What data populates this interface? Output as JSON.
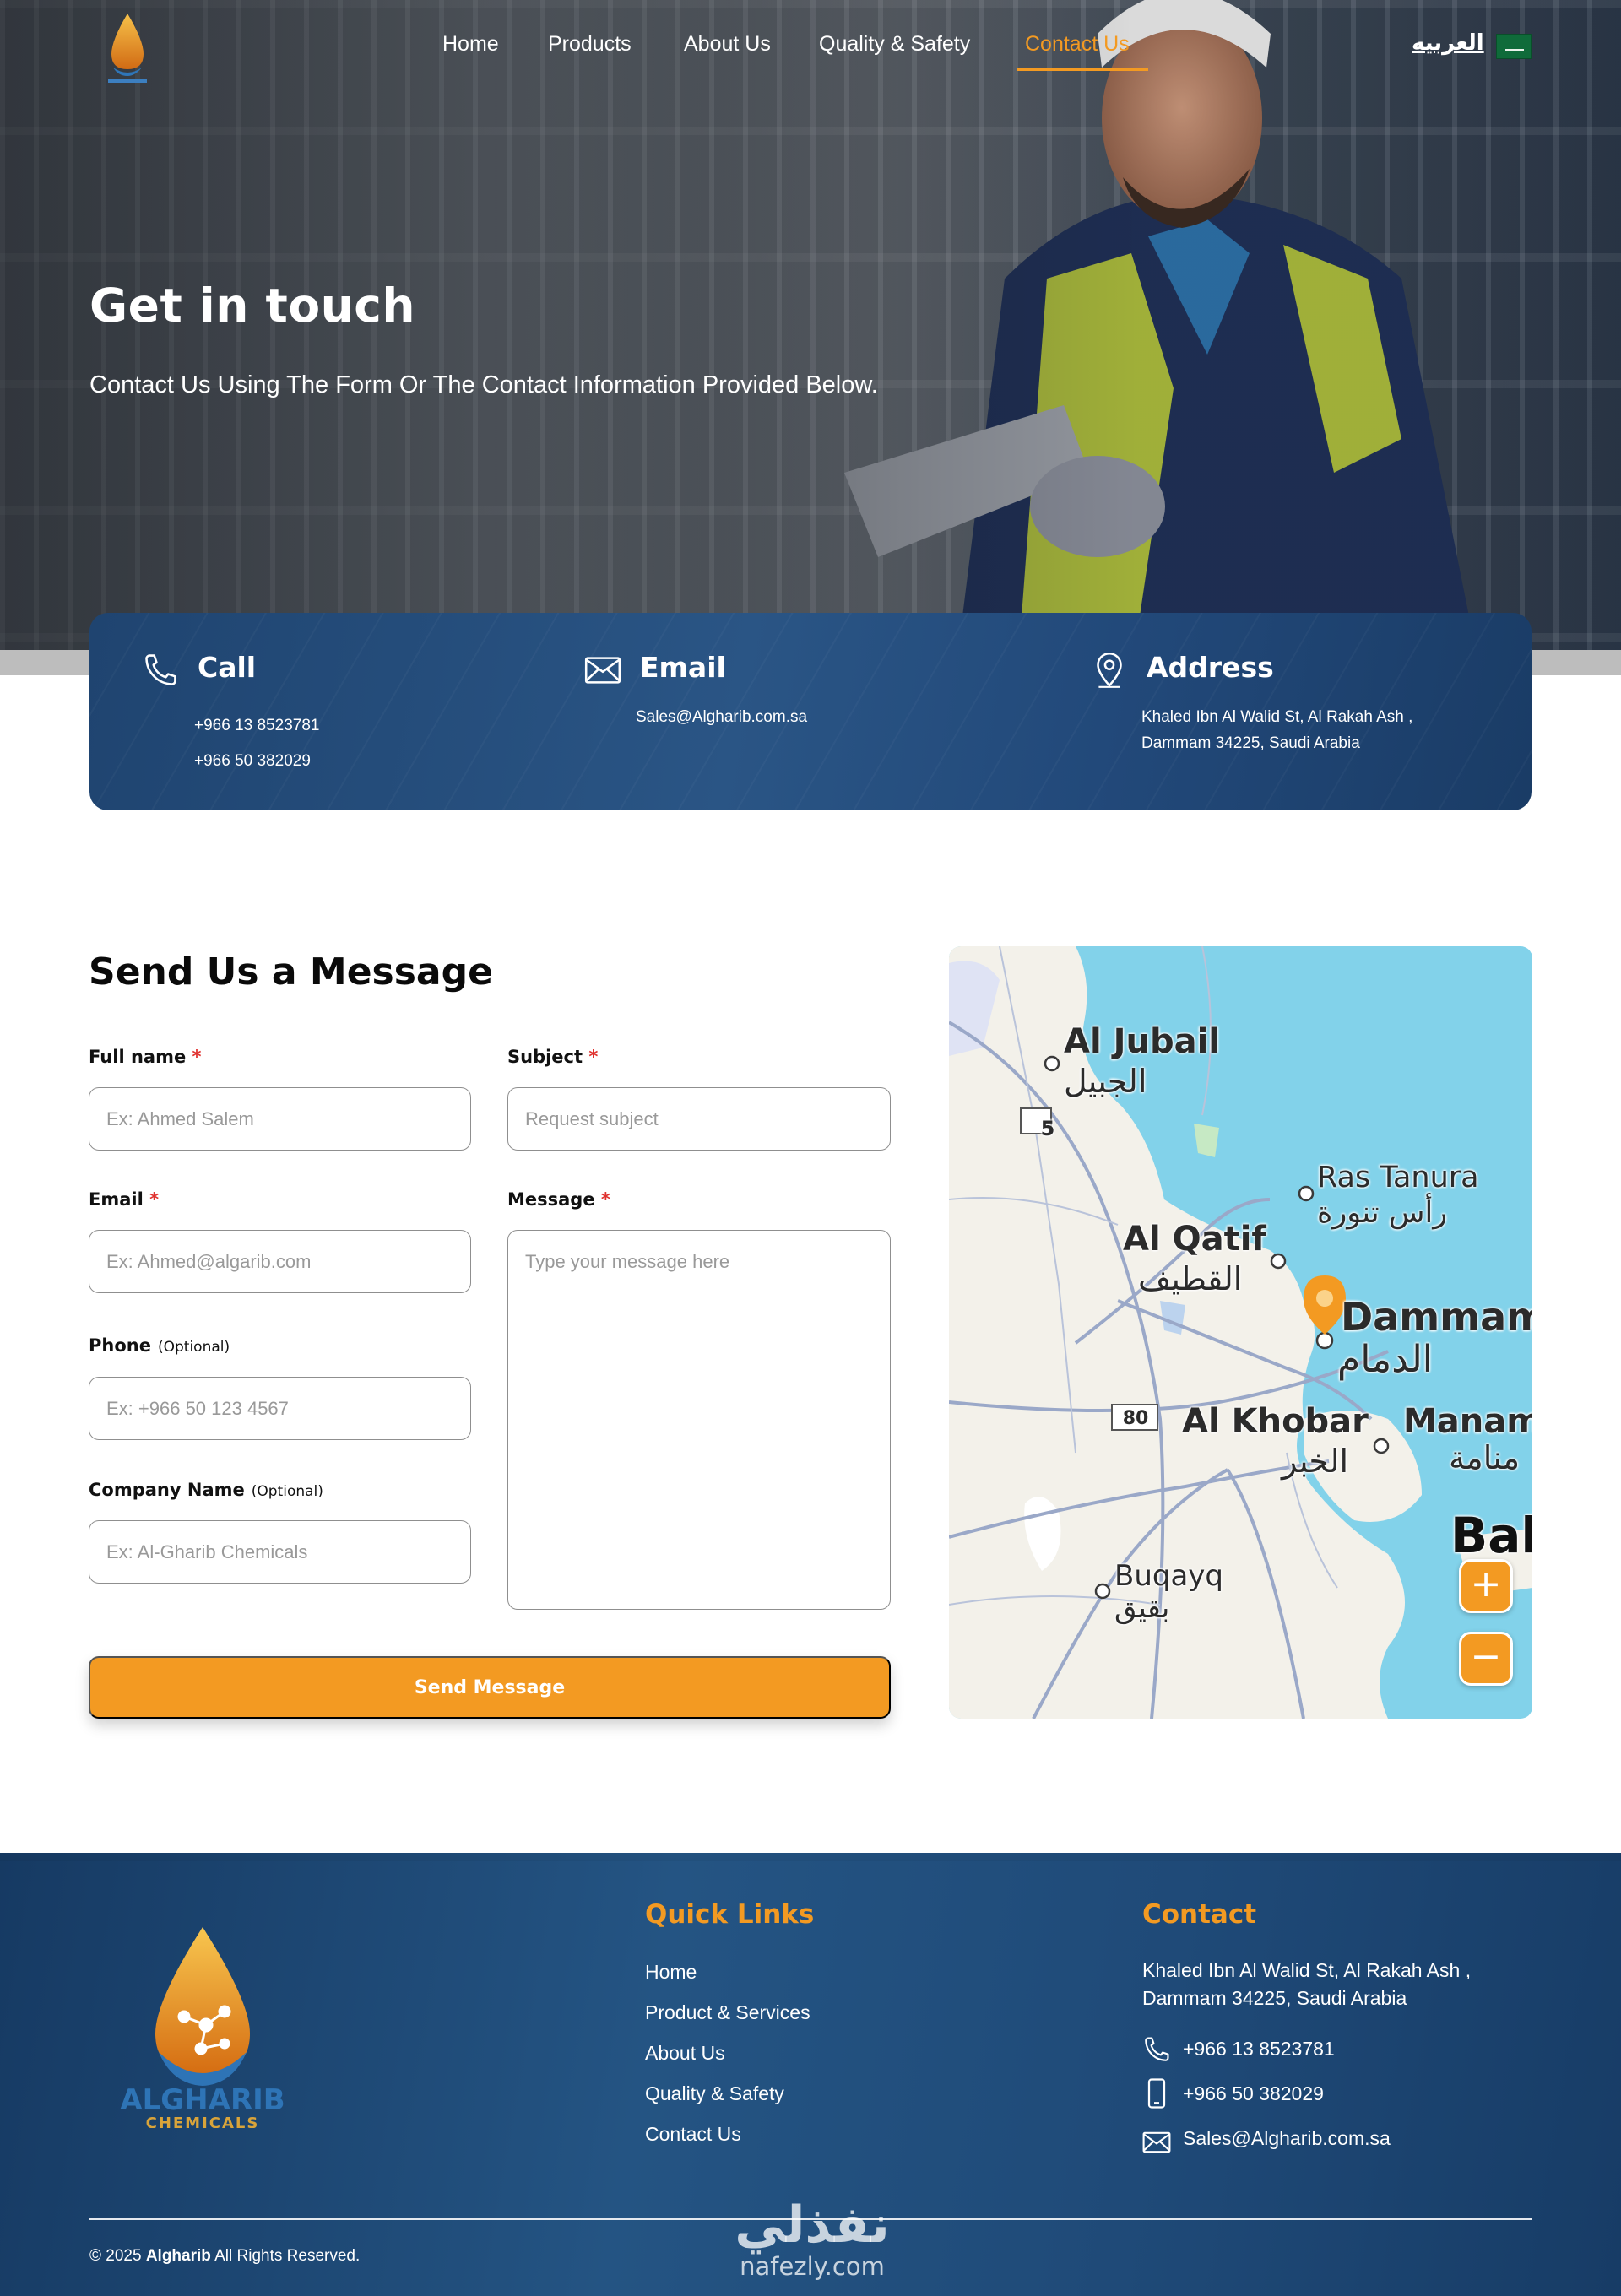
{
  "nav": {
    "items": [
      {
        "label": "Home"
      },
      {
        "label": "Products"
      },
      {
        "label": "About Us"
      },
      {
        "label": "Quality & Safety"
      },
      {
        "label": "Contact Us",
        "active": true
      }
    ],
    "language_label": "العربيه"
  },
  "hero": {
    "title": "Get in touch",
    "subtitle": "Contact Us Using The Form Or The Contact Information Provided Below."
  },
  "contact_card": {
    "call": {
      "title": "Call",
      "phone_1": "+966 13 8523781",
      "phone_2": "+966 50 382029"
    },
    "email": {
      "title": "Email",
      "address": "Sales@Algharib.com.sa"
    },
    "address": {
      "title": "Address",
      "line_1": "Khaled Ibn Al Walid St, Al Rakah Ash ,",
      "line_2": "Dammam 34225, Saudi Arabia"
    }
  },
  "form": {
    "title": "Send Us a Message",
    "full_name": {
      "label": "Full name",
      "required": "*",
      "placeholder": "Ex: Ahmed Salem"
    },
    "subject": {
      "label": "Subject",
      "required": "*",
      "placeholder": "Request subject"
    },
    "email": {
      "label": "Email",
      "required": "*",
      "placeholder": "Ex: Ahmed@algarib.com"
    },
    "message": {
      "label": "Message",
      "required": "*",
      "placeholder": "Type your message here"
    },
    "phone": {
      "label": "Phone",
      "optional": "(Optional)",
      "placeholder": "Ex: +966 50 123 4567"
    },
    "company": {
      "label": "Company Name",
      "optional": "(Optional)",
      "placeholder": "Ex: Al-Gharib Chemicals"
    },
    "submit_label": "Send Message"
  },
  "map": {
    "places": {
      "al_jubail_en": "Al Jubail",
      "al_jubail_ar": "الجبيل",
      "ras_tanura_en": "Ras Tanura",
      "ras_tanura_ar": "رأس تنورة",
      "al_qatif_en": "Al Qatif",
      "al_qatif_ar": "القطيف",
      "dammam_en": "Dammam",
      "dammam_ar": "الدمام",
      "al_khobar_en": "Al Khobar",
      "al_khobar_ar": "الخبر",
      "manama_en": "Manam",
      "manama_ar": "منامة",
      "bahrain_en": "Bal",
      "buqayq_en": "Buqayq",
      "buqayq_ar": "بقيق"
    },
    "road_5": "5",
    "road_80": "80",
    "zoom_in": "+",
    "zoom_out": "−",
    "colors": {
      "water": "#82d2ea",
      "land": "#f3f1ea",
      "road": "#9aa8c8",
      "pin": "#f39a22"
    }
  },
  "footer": {
    "brand_name": "ALGHARIB",
    "brand_sub": "CHEMICALS",
    "quick_links_title": "Quick Links",
    "quick_links": [
      {
        "label": "Home"
      },
      {
        "label": "Product & Services"
      },
      {
        "label": "About Us"
      },
      {
        "label": "Quality & Safety"
      },
      {
        "label": "Contact Us"
      }
    ],
    "contact_title": "Contact",
    "address_line_1": "Khaled Ibn Al Walid St, Al Rakah Ash ,",
    "address_line_2": "Dammam 34225, Saudi Arabia",
    "phone_1": "+966 13 8523781",
    "phone_2": "+966 50 382029",
    "email": "Sales@Algharib.com.sa",
    "copyright_prefix": "© 2025",
    "copyright_brand": "Algharib",
    "copyright_suffix": "All Rights Reserved."
  },
  "watermark": {
    "arabic": "نفذلي",
    "latin": "nafezly.com"
  },
  "colors": {
    "accent": "#f39a22",
    "navy": "#1f4470",
    "required": "#e0322f"
  }
}
